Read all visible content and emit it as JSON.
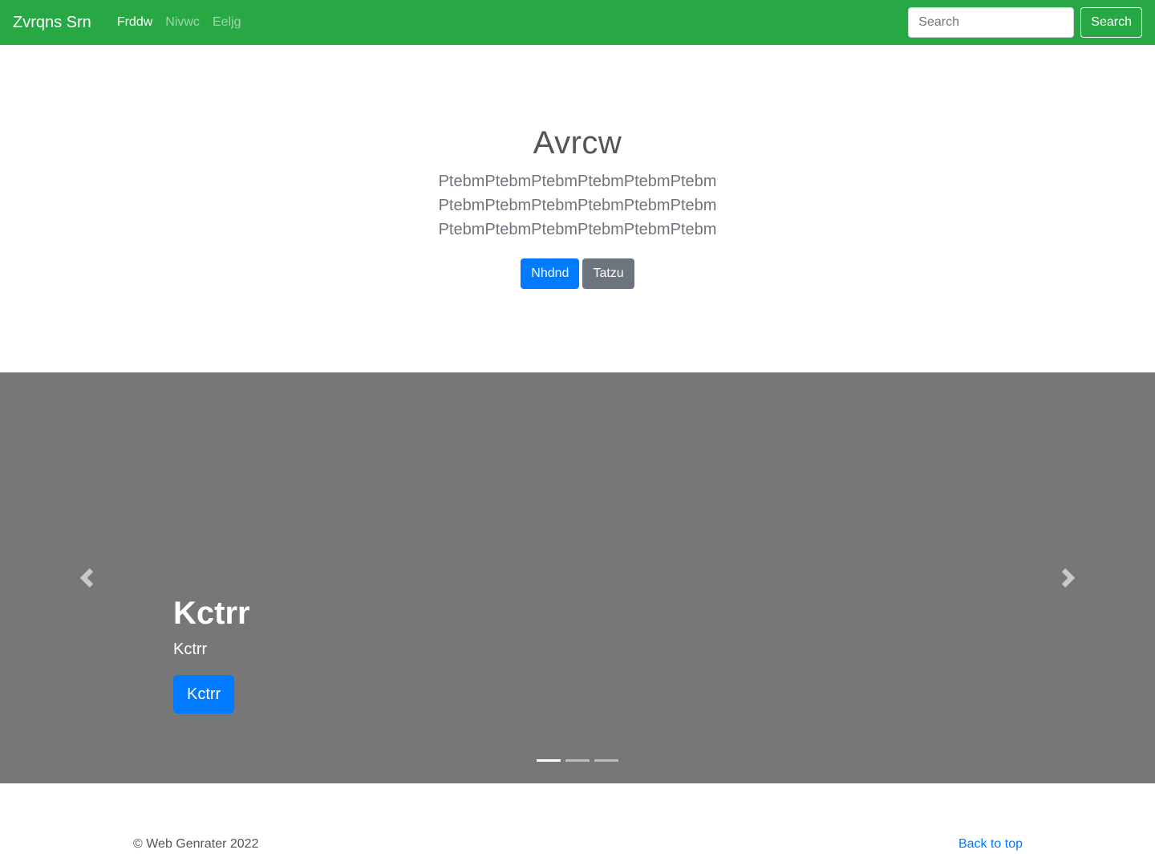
{
  "navbar": {
    "brand": "Zvrqns Srn",
    "links": [
      "Frddw",
      "Nivwc",
      "Eeljg"
    ],
    "search_placeholder": "Search",
    "search_button": "Search",
    "bg_color": "#28a745"
  },
  "jumbotron": {
    "title": "Avrcw",
    "lines": [
      "PtebmPtebmPtebmPtebmPtebmPtebm",
      "PtebmPtebmPtebmPtebmPtebmPtebm",
      "PtebmPtebmPtebmPtebmPtebmPtebm"
    ],
    "primary_button": "Nhdnd",
    "secondary_button": "Tatzu"
  },
  "carousel": {
    "caption_title": "Kctrr",
    "caption_text": "Kctrr",
    "caption_button": "Kctrr",
    "prev_icon": "chevron-left-icon",
    "next_icon": "chevron-right-icon",
    "indicator_count": 3,
    "active_indicator": 0,
    "bg_color": "#777777"
  },
  "footer": {
    "copyright": "© Web Genrater 2022",
    "back_to_top": "Back to top"
  }
}
